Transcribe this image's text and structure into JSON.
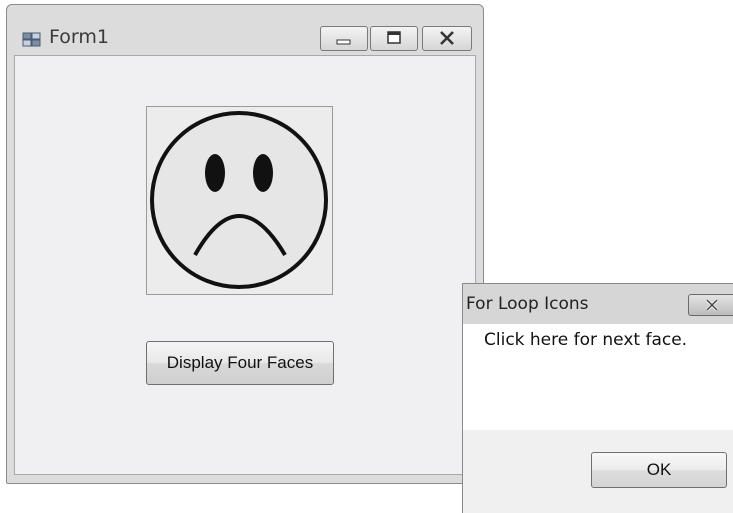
{
  "form": {
    "title": "Form1",
    "display_button_label": "Display Four Faces",
    "picture": {
      "face": "sad-face",
      "border_color": "#9a9a9a"
    }
  },
  "msgbox": {
    "title": "For Loop Icons",
    "message": "Click here for next face.",
    "ok_label": "OK"
  },
  "icons": {
    "app": "windows-form-icon",
    "minimize": "minimize-icon",
    "maximize": "maximize-icon",
    "close": "close-icon"
  },
  "colors": {
    "window_frame": "#dcdcdc",
    "client_area": "#f0f0f2",
    "face_fill": "#e6e6e6",
    "face_stroke": "#111111"
  }
}
